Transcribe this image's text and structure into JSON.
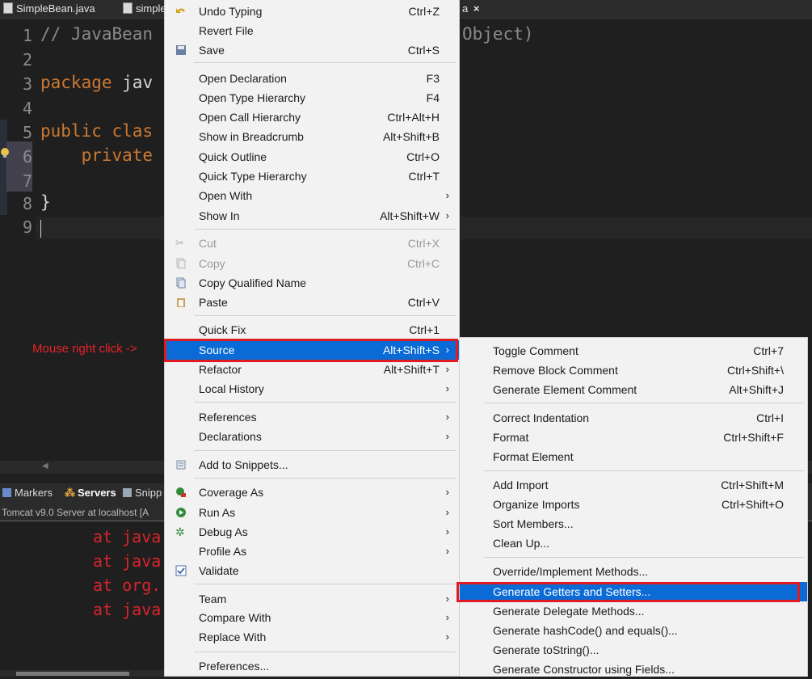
{
  "editor": {
    "tabs": [
      {
        "label": "SimpleBean.java"
      },
      {
        "label": "simple"
      },
      {
        "label": "a"
      }
    ],
    "tab_close": "×",
    "line_numbers": [
      "1",
      "2",
      "3",
      "4",
      "5",
      "6",
      "7",
      "8",
      "9"
    ],
    "code": {
      "l1_comment": "// JavaBean",
      "l1_tail": "Object)",
      "l3_kw": "package",
      "l3_rest": " jav",
      "l5_kw": "public clas",
      "l6_kw": "    private",
      "l8": "}"
    }
  },
  "bottom_panel": {
    "tabs": [
      {
        "label": "Markers"
      },
      {
        "label": "Servers"
      },
      {
        "label": "Snipp"
      }
    ],
    "subheader": "Tomcat v9.0 Server at localhost [A",
    "console_lines": [
      "at java",
      "at java",
      "at org.",
      "at java"
    ]
  },
  "annotation": "Mouse right click ->",
  "context_menu": {
    "items": [
      {
        "label": "Undo Typing",
        "shortcut": "Ctrl+Z"
      },
      {
        "label": "Revert File",
        "shortcut": ""
      },
      {
        "label": "Save",
        "shortcut": "Ctrl+S"
      },
      {
        "label": "Open Declaration",
        "shortcut": "F3"
      },
      {
        "label": "Open Type Hierarchy",
        "shortcut": "F4"
      },
      {
        "label": "Open Call Hierarchy",
        "shortcut": "Ctrl+Alt+H"
      },
      {
        "label": "Show in Breadcrumb",
        "shortcut": "Alt+Shift+B"
      },
      {
        "label": "Quick Outline",
        "shortcut": "Ctrl+O"
      },
      {
        "label": "Quick Type Hierarchy",
        "shortcut": "Ctrl+T"
      },
      {
        "label": "Open With",
        "shortcut": ""
      },
      {
        "label": "Show In",
        "shortcut": "Alt+Shift+W"
      },
      {
        "label": "Cut",
        "shortcut": "Ctrl+X"
      },
      {
        "label": "Copy",
        "shortcut": "Ctrl+C"
      },
      {
        "label": "Copy Qualified Name",
        "shortcut": ""
      },
      {
        "label": "Paste",
        "shortcut": "Ctrl+V"
      },
      {
        "label": "Quick Fix",
        "shortcut": "Ctrl+1"
      },
      {
        "label": "Source",
        "shortcut": "Alt+Shift+S"
      },
      {
        "label": "Refactor",
        "shortcut": "Alt+Shift+T"
      },
      {
        "label": "Local History",
        "shortcut": ""
      },
      {
        "label": "References",
        "shortcut": ""
      },
      {
        "label": "Declarations",
        "shortcut": ""
      },
      {
        "label": "Add to Snippets...",
        "shortcut": ""
      },
      {
        "label": "Coverage As",
        "shortcut": ""
      },
      {
        "label": "Run As",
        "shortcut": ""
      },
      {
        "label": "Debug As",
        "shortcut": ""
      },
      {
        "label": "Profile As",
        "shortcut": ""
      },
      {
        "label": "Validate",
        "shortcut": ""
      },
      {
        "label": "Team",
        "shortcut": ""
      },
      {
        "label": "Compare With",
        "shortcut": ""
      },
      {
        "label": "Replace With",
        "shortcut": ""
      },
      {
        "label": "Preferences...",
        "shortcut": ""
      }
    ],
    "submenu_arrow": "›"
  },
  "source_submenu": {
    "items": [
      {
        "label": "Toggle Comment",
        "shortcut": "Ctrl+7"
      },
      {
        "label": "Remove Block Comment",
        "shortcut": "Ctrl+Shift+\\"
      },
      {
        "label": "Generate Element Comment",
        "shortcut": "Alt+Shift+J"
      },
      {
        "label": "Correct Indentation",
        "shortcut": "Ctrl+I"
      },
      {
        "label": "Format",
        "shortcut": "Ctrl+Shift+F"
      },
      {
        "label": "Format Element",
        "shortcut": ""
      },
      {
        "label": "Add Import",
        "shortcut": "Ctrl+Shift+M"
      },
      {
        "label": "Organize Imports",
        "shortcut": "Ctrl+Shift+O"
      },
      {
        "label": "Sort Members...",
        "shortcut": ""
      },
      {
        "label": "Clean Up...",
        "shortcut": ""
      },
      {
        "label": "Override/Implement Methods...",
        "shortcut": ""
      },
      {
        "label": "Generate Getters and Setters...",
        "shortcut": ""
      },
      {
        "label": "Generate Delegate Methods...",
        "shortcut": ""
      },
      {
        "label": "Generate hashCode() and equals()...",
        "shortcut": ""
      },
      {
        "label": "Generate toString()...",
        "shortcut": ""
      },
      {
        "label": "Generate Constructor using Fields...",
        "shortcut": ""
      }
    ]
  },
  "colors": {
    "menu_selection": "#0a6bd6",
    "highlight_box": "#e01b24",
    "keyword": "#cc7832",
    "console_error": "#d9242d"
  }
}
